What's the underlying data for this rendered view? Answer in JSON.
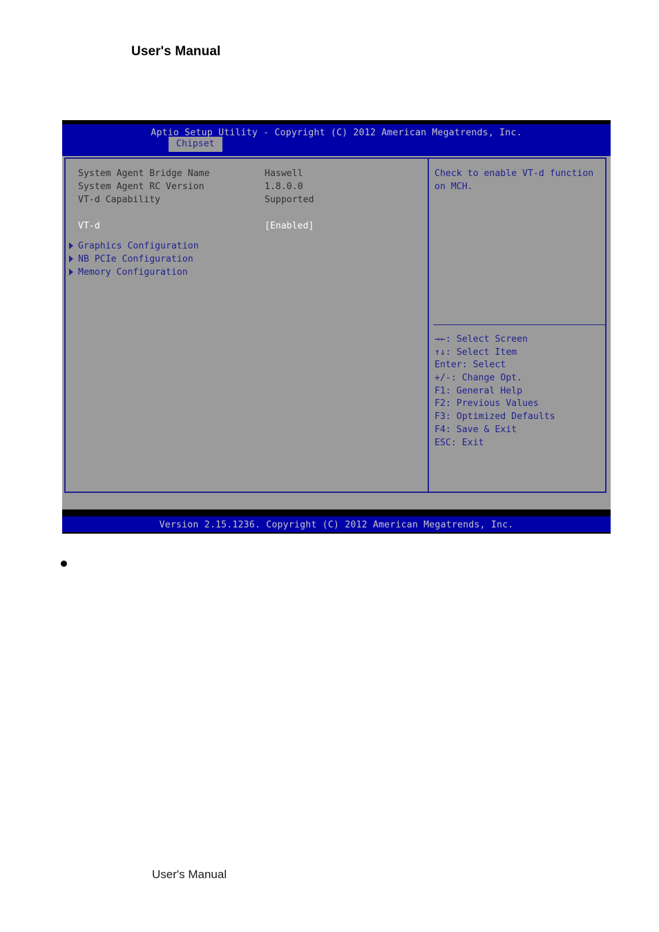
{
  "document": {
    "header_title": "User's Manual",
    "footer_title": "User's Manual",
    "bullet_glyph": "●"
  },
  "bios": {
    "title": "Aptio Setup Utility - Copyright (C) 2012 American Megatrends, Inc.",
    "footer": "Version 2.15.1236. Copyright (C) 2012 American Megatrends, Inc.",
    "tabs": [
      {
        "label": "Chipset",
        "selected": true
      }
    ],
    "settings": [
      {
        "label": "System Agent Bridge Name",
        "value": "Haswell",
        "active": false
      },
      {
        "label": "System Agent RC Version",
        "value": "1.8.0.0",
        "active": false
      },
      {
        "label": "VT-d Capability",
        "value": "Supported",
        "active": false
      },
      {
        "label": "",
        "value": "",
        "active": false
      },
      {
        "label": "VT-d",
        "value": "[Enabled]",
        "active": true
      }
    ],
    "submenus": [
      {
        "label": "Graphics Configuration",
        "marker": "▶"
      },
      {
        "label": "NB PCIe Configuration",
        "marker": "▶"
      },
      {
        "label": "Memory Configuration",
        "marker": "▶"
      }
    ],
    "help": {
      "text": "Check to enable VT-d function\non MCH."
    },
    "legend": [
      "→←: Select Screen",
      "↑↓: Select Item",
      "Enter: Select",
      "+/-: Change Opt.",
      "F1: General Help",
      "F2: Previous Values",
      "F3: Optimized Defaults",
      "F4: Save & Exit",
      "ESC: Exit"
    ],
    "colors": {
      "header_blue": "#0000A8",
      "panel_gray": "#9B9B9B",
      "accent_blue": "#21218F",
      "selected_text": "#FFFFFF",
      "normal_text": "#2E2E2E",
      "title_text": "#C8C8C8"
    }
  }
}
